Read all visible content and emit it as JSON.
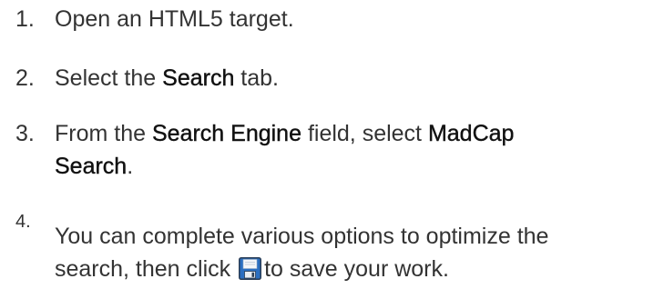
{
  "steps": [
    {
      "number": "1.",
      "parts": {
        "a": "Open an HTML5 target."
      }
    },
    {
      "number": "2.",
      "parts": {
        "a": "Select the ",
        "b": "Search",
        "c": " tab."
      }
    },
    {
      "number": "3.",
      "line1": {
        "a": "From the ",
        "b": "Search Engine",
        "c": " field, select ",
        "d": "MadCap"
      },
      "line2": {
        "a": "Search",
        "b": "."
      }
    },
    {
      "number": "4.",
      "line1": {
        "a": "You can complete various options to optimize the"
      },
      "line2": {
        "a": "search, then click ",
        "b": "to save your work."
      }
    }
  ],
  "icons": {
    "save": "save-icon"
  },
  "colors": {
    "text": "#333333",
    "emphasis": "#111111",
    "icon_blue": "#2b6fc1",
    "icon_border": "#2a3d55"
  }
}
